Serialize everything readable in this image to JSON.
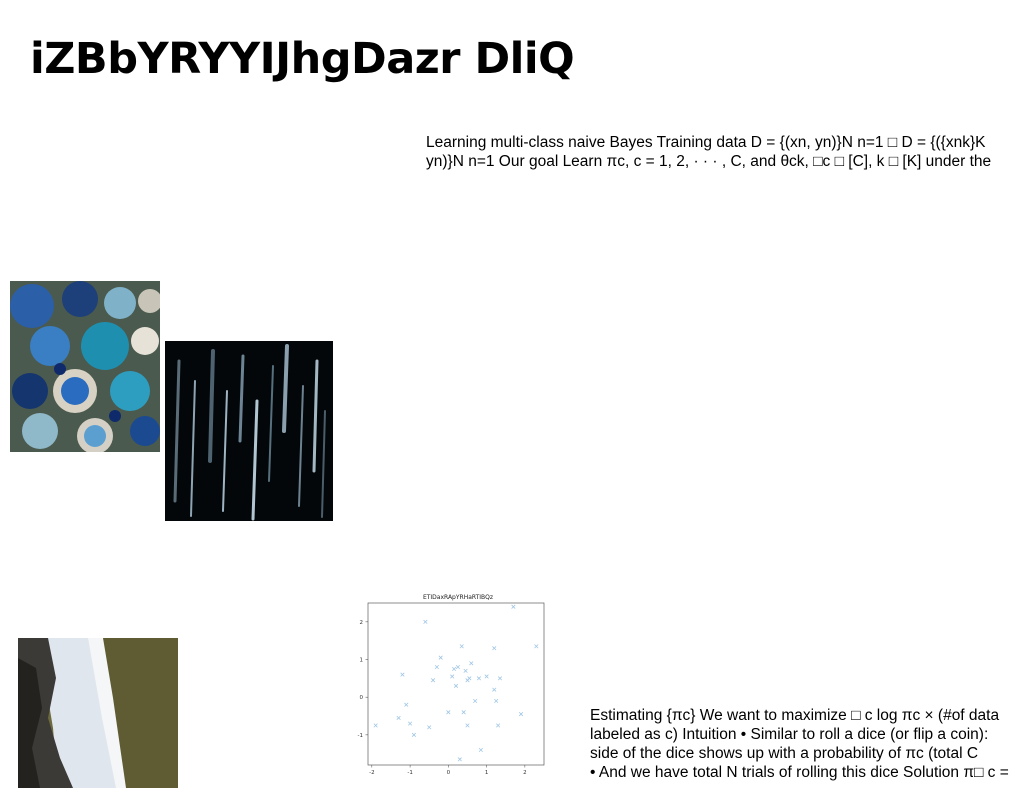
{
  "page": {
    "title": "iZBbYRYYIJhgDazr DliQ"
  },
  "paragraph_1": {
    "lines": [
      "Learning multi-class naive Bayes Training data D = {(xn, yn)}N n=1 □ D = {({xnk}K",
      "yn)}N n=1 Our goal Learn πc, c = 1, 2, · · · , C, and θck, □c □ [C], k □ [K] under the"
    ]
  },
  "paragraph_2": {
    "lines": [
      "Estimating {πc} We want to maximize □ c log πc × (#of data",
      "labeled as c) Intuition • Similar to roll a dice (or flip a coin):",
      "side of the dice shows up with a probability of πc (total C",
      "• And we have total N trials of rolling this dice Solution π□ c ="
    ]
  },
  "images": {
    "bowls": "photo-blue-ceramic-bowls",
    "streaks": "photo-dark-light-streaks",
    "cliff": "photo-coastal-cliff-beach"
  },
  "chart_data": {
    "type": "scatter",
    "title": "ETIDaxRApYRHaRTIBQz",
    "xlabel": "",
    "ylabel": "",
    "xlim": [
      -2.1,
      2.5
    ],
    "ylim": [
      -1.8,
      2.5
    ],
    "xticks": [
      -2,
      -1,
      0,
      1,
      2
    ],
    "yticks": [
      -1,
      0,
      1,
      2
    ],
    "marker": "x",
    "color": "#9fc6e6",
    "series": [
      {
        "x": [
          -1.9,
          -1.2,
          -1.1,
          -1.0,
          -0.9,
          -0.6,
          -0.5,
          -0.4,
          -0.3,
          -0.2,
          0.0,
          0.1,
          0.15,
          0.2,
          0.25,
          0.3,
          0.35,
          0.4,
          0.45,
          0.5,
          0.55,
          0.6,
          0.7,
          0.8,
          0.85,
          1.0,
          1.2,
          1.2,
          1.25,
          1.3,
          1.35,
          1.7,
          1.9,
          2.3,
          -1.3,
          0.5
        ],
        "y": [
          -0.75,
          0.6,
          -0.2,
          -0.7,
          -1.0,
          2.0,
          -0.8,
          0.45,
          0.8,
          1.05,
          -0.4,
          0.55,
          0.75,
          0.3,
          0.8,
          -1.65,
          1.35,
          -0.4,
          0.7,
          -0.75,
          0.5,
          0.9,
          -0.1,
          0.5,
          -1.4,
          0.55,
          0.2,
          1.3,
          -0.1,
          -0.75,
          0.5,
          2.4,
          -0.45,
          1.35,
          -0.55,
          0.45
        ]
      }
    ]
  }
}
